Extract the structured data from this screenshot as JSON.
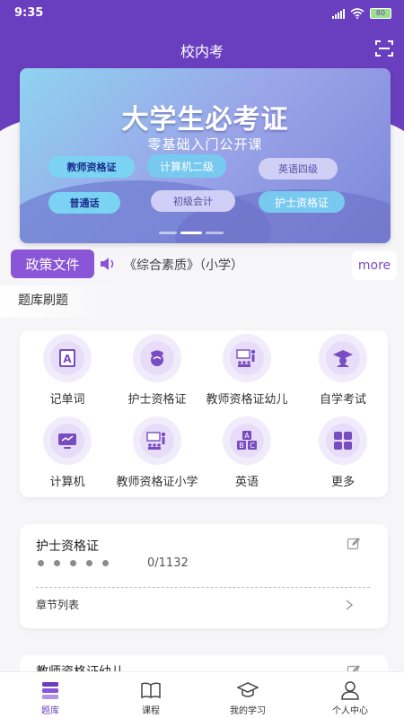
{
  "status_bar": {
    "time": "9:35",
    "battery": "80"
  },
  "header": {
    "title": "校内考"
  },
  "banner": {
    "title": "大学生必考证",
    "subtitle": "零基础入门公开课",
    "tags": [
      "教师资格证",
      "计算机二级",
      "英语四级",
      "普通话",
      "初级会计",
      "护士资格证"
    ]
  },
  "notice": {
    "tag_label": "政策文件",
    "text": "《综合素质》（小学）",
    "more_label": "more"
  },
  "section": {
    "title": "题库刷题"
  },
  "grid": {
    "items": [
      {
        "label": "记单词",
        "icon": "letter-a-icon"
      },
      {
        "label": "护士资格证",
        "icon": "nurse-icon"
      },
      {
        "label": "教师资格证幼儿",
        "icon": "teacher-board-icon"
      },
      {
        "label": "自学考试",
        "icon": "graduation-cap-icon"
      },
      {
        "label": "计算机",
        "icon": "computer-icon"
      },
      {
        "label": "教师资格证小学",
        "icon": "classroom-icon"
      },
      {
        "label": "英语",
        "icon": "abc-blocks-icon"
      },
      {
        "label": "更多",
        "icon": "grid-more-icon"
      }
    ]
  },
  "study_cards": [
    {
      "title": "护士资格证",
      "progress": "0/1132",
      "chapter_label": "章节列表"
    },
    {
      "title": "教师资格证幼儿"
    }
  ],
  "tabbar": {
    "items": [
      {
        "label": "题库",
        "active": true
      },
      {
        "label": "课程",
        "active": false
      },
      {
        "label": "我的学习",
        "active": false
      },
      {
        "label": "个人中心",
        "active": false
      }
    ]
  },
  "colors": {
    "primary": "#6a3fbf",
    "accent": "#8a55d6",
    "background": "#f6f6f8"
  }
}
